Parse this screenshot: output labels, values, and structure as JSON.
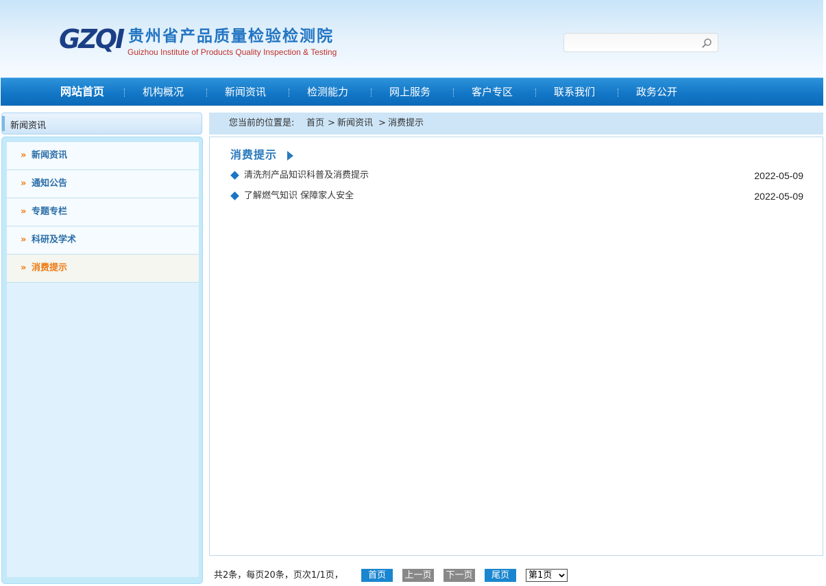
{
  "header": {
    "logo_mark": "GZQI",
    "org_name_cn": "贵州省产品质量检验检测院",
    "org_name_en": "Guizhou Institute of Products Quality  Inspection & Testing",
    "search_placeholder": "",
    "search_value": ""
  },
  "nav": {
    "items": [
      {
        "label": "网站首页"
      },
      {
        "label": "机构概况"
      },
      {
        "label": "新闻资讯"
      },
      {
        "label": "检测能力"
      },
      {
        "label": "网上服务"
      },
      {
        "label": "客户专区"
      },
      {
        "label": "联系我们"
      },
      {
        "label": "政务公开"
      }
    ]
  },
  "sidebar": {
    "heading": "新闻资讯",
    "items": [
      {
        "label": "新闻资讯",
        "active": false
      },
      {
        "label": "通知公告",
        "active": false
      },
      {
        "label": "专题专栏",
        "active": false
      },
      {
        "label": "科研及学术",
        "active": false
      },
      {
        "label": "消费提示",
        "active": true
      }
    ]
  },
  "breadcrumb": {
    "prefix": "您当前的位置是:",
    "items": [
      "首页",
      "新闻资讯",
      "消费提示"
    ],
    "separator": ">"
  },
  "main": {
    "category_title": "消费提示",
    "articles": [
      {
        "title": "清洗剂产品知识科普及消费提示",
        "date": "2022-05-09"
      },
      {
        "title": "了解燃气知识 保障家人安全",
        "date": "2022-05-09"
      }
    ]
  },
  "pagination": {
    "summary": "共2条，每页20条，页次1/1页，",
    "first": "首页",
    "prev": "上一页",
    "next": "下一页",
    "last": "尾页",
    "page_select_value": "第1页"
  },
  "colors": {
    "nav_blue": "#1377c7",
    "accent_orange": "#ee7a14",
    "link_blue": "#2a79bd"
  }
}
